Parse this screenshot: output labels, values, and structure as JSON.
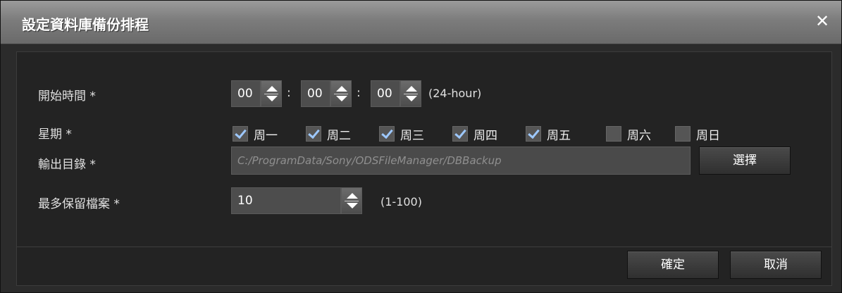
{
  "dialog": {
    "title": "設定資料庫備份排程",
    "close_symbol": "✕"
  },
  "form": {
    "start_time_label": "開始時間 *",
    "start_time": {
      "hour": "00",
      "minute": "00",
      "second": "00",
      "colon": ":",
      "hint": "(24-hour)"
    },
    "weekday_label": "星期 *",
    "weekdays": [
      {
        "label": "周一",
        "checked": true
      },
      {
        "label": "周二",
        "checked": true
      },
      {
        "label": "周三",
        "checked": true
      },
      {
        "label": "周四",
        "checked": true
      },
      {
        "label": "周五",
        "checked": true
      },
      {
        "label": "周六",
        "checked": false
      },
      {
        "label": "周日",
        "checked": false
      }
    ],
    "output_dir_label": "輸出目錄 *",
    "output_dir_value": "C:/ProgramData/Sony/ODSFileManager/DBBackup",
    "select_button": "選擇",
    "max_files_label": "最多保留檔案 *",
    "max_files_value": "10",
    "max_files_hint": "(1-100)"
  },
  "footer": {
    "ok_button": "確定",
    "cancel_button": "取消"
  }
}
